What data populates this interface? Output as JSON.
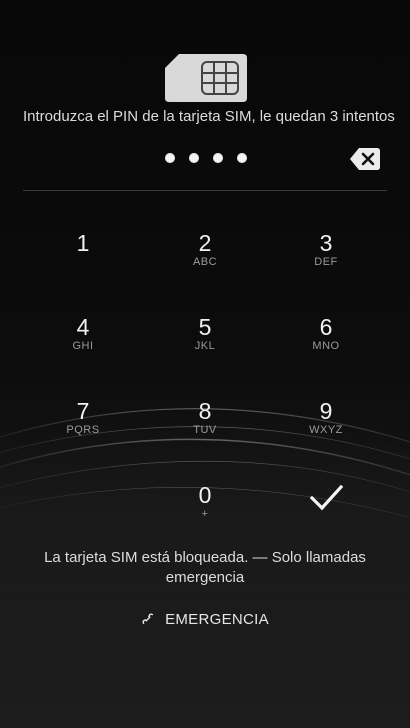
{
  "sim_prompt": "Introduzca el PIN de la tarjeta SIM, le quedan 3 intentos",
  "pin": {
    "entered_count": 4
  },
  "keypad": {
    "keys": [
      {
        "digit": "1",
        "letters": ""
      },
      {
        "digit": "2",
        "letters": "ABC"
      },
      {
        "digit": "3",
        "letters": "DEF"
      },
      {
        "digit": "4",
        "letters": "GHI"
      },
      {
        "digit": "5",
        "letters": "JKL"
      },
      {
        "digit": "6",
        "letters": "MNO"
      },
      {
        "digit": "7",
        "letters": "PQRS"
      },
      {
        "digit": "8",
        "letters": "TUV"
      },
      {
        "digit": "9",
        "letters": "WXYZ"
      },
      {
        "digit": "0",
        "letters": "+"
      }
    ],
    "ok_icon": "checkmark-icon",
    "backspace_icon": "backspace-icon"
  },
  "status_message": "La tarjeta SIM está bloqueada. — Solo llamadas emergencia",
  "emergency_button": {
    "label": "EMERGENCIA",
    "icon": "phone-icon"
  },
  "colors": {
    "background": "#0a0a0a",
    "text": "#f2f2f2",
    "secondary_text": "#9a9a9a"
  }
}
